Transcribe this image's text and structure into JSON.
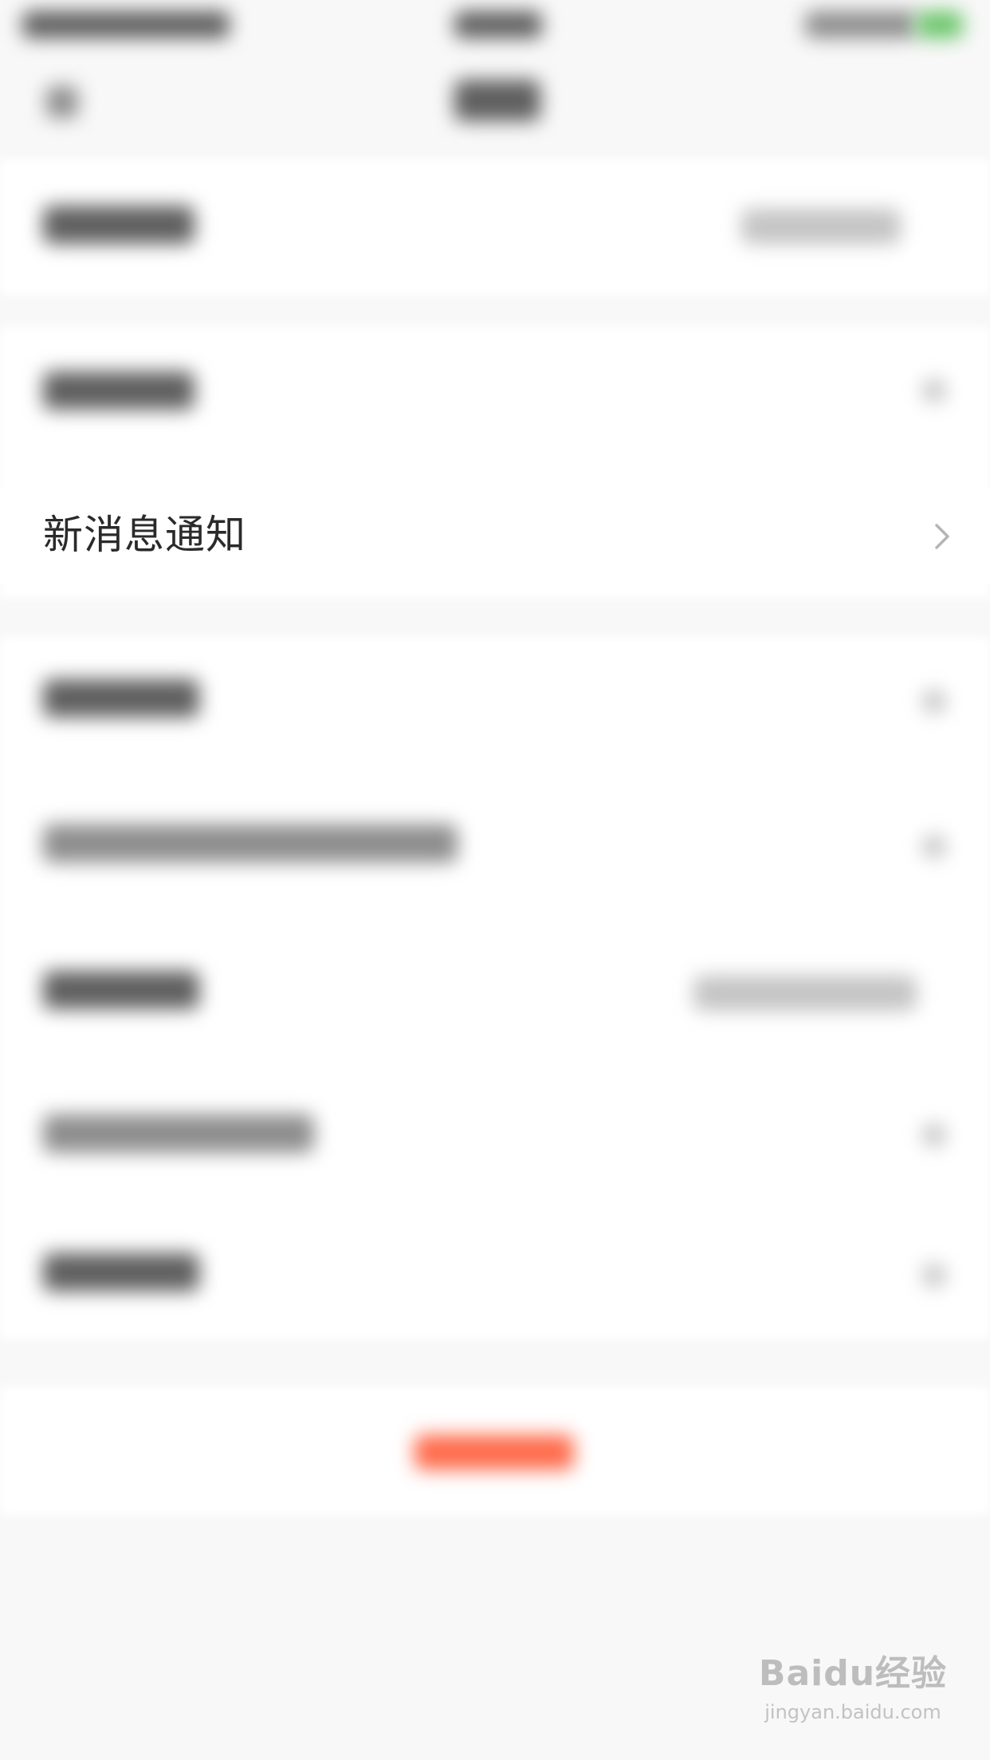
{
  "settings": {
    "notification_row_label": "新消息通知"
  },
  "icons": {
    "row_chevron": "chevron-right-icon"
  },
  "colors": {
    "chevron": "#b5b5b5",
    "text": "#2a2a2a",
    "logout": "#ff6a4a"
  },
  "watermark": {
    "brand": "Baidu经验",
    "url": "jingyan.baidu.com"
  }
}
